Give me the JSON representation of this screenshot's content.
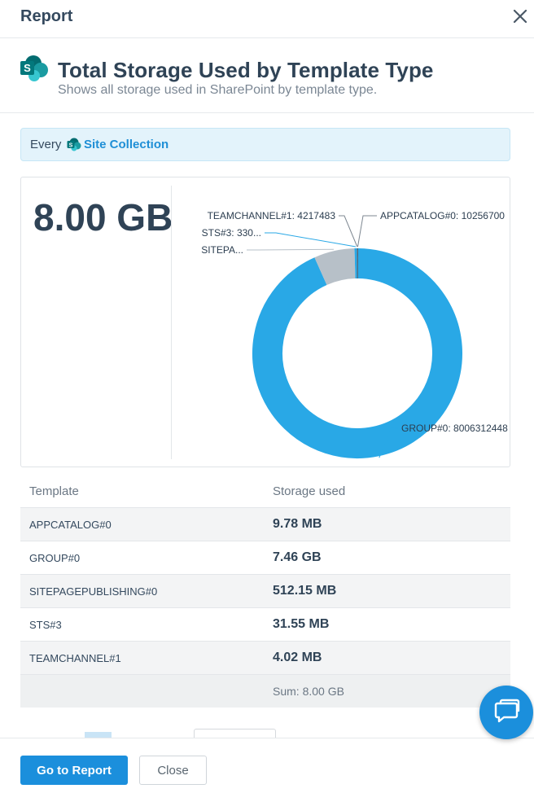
{
  "dialog": {
    "title": "Report",
    "close_icon": "close-icon"
  },
  "report": {
    "icon": "sharepoint-logo-icon",
    "title": "Total Storage Used by Template Type",
    "subtitle": "Shows all storage used in SharePoint by template type."
  },
  "filter": {
    "prefix": "Every",
    "icon": "sharepoint-site-icon",
    "link_label": "Site Collection"
  },
  "summary": {
    "total": "8.00 GB"
  },
  "colors": {
    "accent": "#1b8fdc",
    "donut_primary": "#29a8e6",
    "donut_secondary": "#b7c0c8",
    "donut_small": "#3a4652"
  },
  "chart_data": {
    "type": "pie",
    "style": "donut",
    "slices": [
      {
        "label": "APPCATALOG#0: 10256700",
        "category": "APPCATALOG#0",
        "value": 10256700
      },
      {
        "label": "GROUP#0: 8006312448",
        "category": "GROUP#0",
        "value": 8006312448
      },
      {
        "label": "SITEPA...",
        "category": "SITEPAGEPUBLISHING#0",
        "value": 537031475
      },
      {
        "label": "STS#3: 330...",
        "category": "STS#3",
        "value": 33082573
      },
      {
        "label": "TEAMCHANNEL#1: 4217483",
        "category": "TEAMCHANNEL#1",
        "value": 4217483
      }
    ]
  },
  "table": {
    "headers": [
      "Template",
      "Storage used"
    ],
    "rows": [
      {
        "template": "APPCATALOG#0",
        "storage": "9.78 MB"
      },
      {
        "template": "GROUP#0",
        "storage": "7.46 GB"
      },
      {
        "template": "SITEPAGEPUBLISHING#0",
        "storage": "512.15 MB"
      },
      {
        "template": "STS#3",
        "storage": "31.55 MB"
      },
      {
        "template": "TEAMCHANNEL#1",
        "storage": "4.02 MB"
      }
    ],
    "sum": "Sum: 8.00 GB"
  },
  "footer": {
    "primary_label": "Go to Report",
    "secondary_label": "Close"
  },
  "chat": {
    "icon": "chat-bubble-icon"
  }
}
